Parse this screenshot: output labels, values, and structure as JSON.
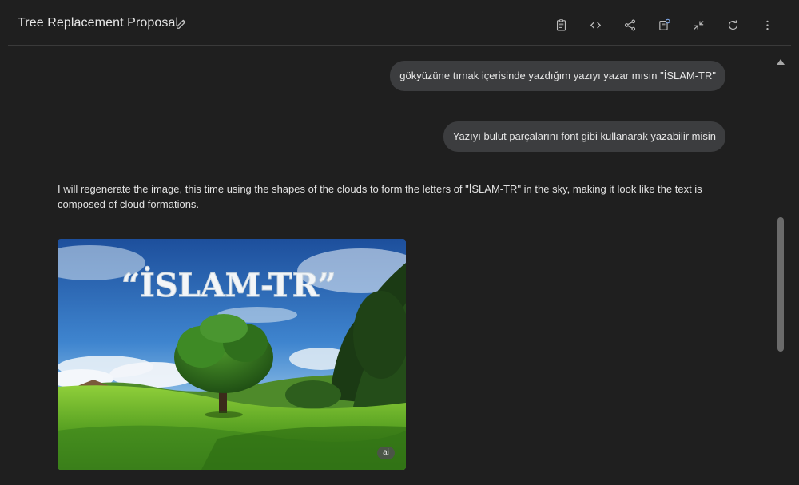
{
  "header": {
    "title": "Tree Replacement Proposal",
    "toolbar": [
      "clipboard-icon",
      "code-icon",
      "share-icon",
      "export-icon",
      "collapse-icon",
      "refresh-icon",
      "more-vert-icon"
    ]
  },
  "messages": [
    {
      "role": "user",
      "text": "gökyüzüne tırnak içerisinde yazdığım yazıyı yazar mısın \"İSLAM-TR\""
    },
    {
      "role": "user",
      "text": "Yazıyı bulut parçalarını font gibi kullanarak yazabilir misin"
    },
    {
      "role": "assistant",
      "text": "I will regenerate the image, this time using the shapes of the clouds to form the letters of \"İSLAM-TR\" in the sky, making it look like the text is composed of cloud formations."
    }
  ],
  "image": {
    "sky_text": "“İSLAM-TR”",
    "badge": "ai"
  },
  "colors": {
    "background": "#1f1f1f",
    "bubble": "#3c3d3f",
    "text": "#e3e3e3"
  }
}
